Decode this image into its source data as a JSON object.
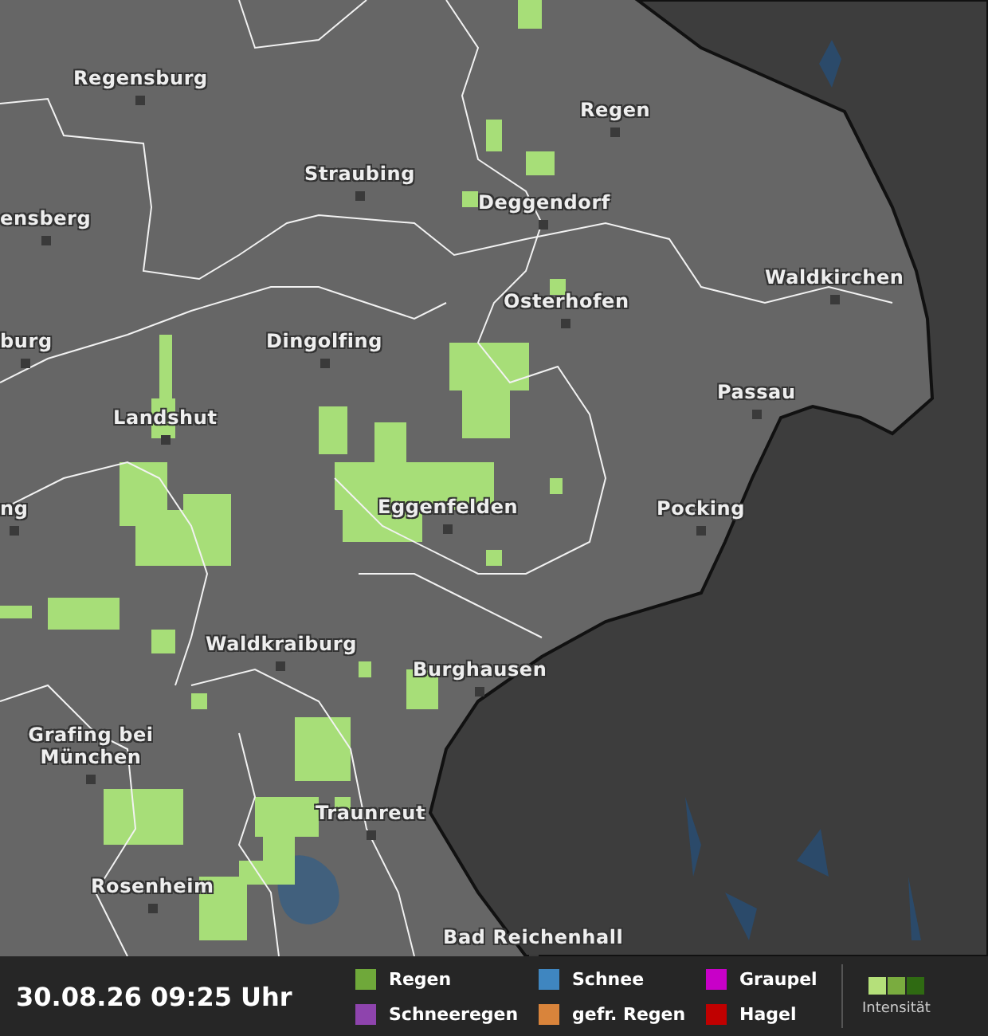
{
  "map": {
    "cities": [
      {
        "name": "Regensburg"
      },
      {
        "name": "Regen"
      },
      {
        "name": "Straubing"
      },
      {
        "name": "ensberg"
      },
      {
        "name": "Deggendorf"
      },
      {
        "name": "Osterhofen"
      },
      {
        "name": "Waldkirchen"
      },
      {
        "name": "burg"
      },
      {
        "name": "Dingolfing"
      },
      {
        "name": "Passau"
      },
      {
        "name": "Landshut"
      },
      {
        "name": "ng"
      },
      {
        "name": "Eggenfelden"
      },
      {
        "name": "Pocking"
      },
      {
        "name": "Waldkraiburg"
      },
      {
        "name": "Burghausen"
      },
      {
        "name": "Grafing bei München"
      },
      {
        "name": "Traunreut"
      },
      {
        "name": "Rosenheim"
      },
      {
        "name": "Bad Reichenhall"
      }
    ]
  },
  "status_bar": {
    "timestamp": "30.08.26 09:25 Uhr",
    "legend": [
      {
        "label": "Regen",
        "color": "#6fa83a"
      },
      {
        "label": "Schneeregen",
        "color": "#8e44ad"
      },
      {
        "label": "Schnee",
        "color": "#3f86c0"
      },
      {
        "label": "gefr. Regen",
        "color": "#d9843b"
      },
      {
        "label": "Graupel",
        "color": "#c800c8"
      },
      {
        "label": "Hagel",
        "color": "#c00000"
      }
    ],
    "intensity": {
      "label": "Intensität"
    }
  }
}
